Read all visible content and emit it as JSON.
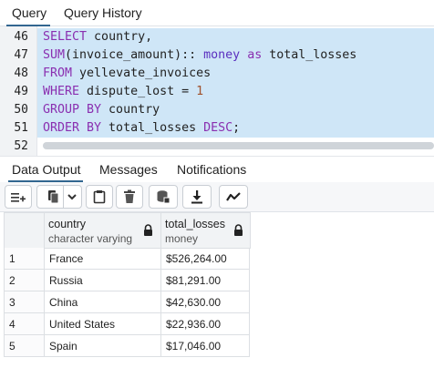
{
  "top_tabs": [
    {
      "label": "Query"
    },
    {
      "label": "Query History"
    }
  ],
  "editor": {
    "line_numbers": [
      "46",
      "47",
      "48",
      "49",
      "50",
      "51",
      "52"
    ],
    "lines": [
      [
        {
          "t": "SELECT",
          "c": "kw"
        },
        {
          "t": " country,",
          "c": ""
        }
      ],
      [
        {
          "t": "SUM",
          "c": "fn"
        },
        {
          "t": "(invoice_amount):: ",
          "c": ""
        },
        {
          "t": "money",
          "c": "tp"
        },
        {
          "t": " ",
          "c": ""
        },
        {
          "t": "as",
          "c": "kw"
        },
        {
          "t": " total_losses",
          "c": ""
        }
      ],
      [
        {
          "t": "FROM",
          "c": "kw"
        },
        {
          "t": " yellevate_invoices",
          "c": ""
        }
      ],
      [
        {
          "t": "WHERE",
          "c": "kw"
        },
        {
          "t": " dispute_lost = ",
          "c": ""
        },
        {
          "t": "1",
          "c": "num"
        }
      ],
      [
        {
          "t": "GROUP BY",
          "c": "kw"
        },
        {
          "t": " country",
          "c": ""
        }
      ],
      [
        {
          "t": "ORDER BY",
          "c": "kw"
        },
        {
          "t": " total_losses ",
          "c": ""
        },
        {
          "t": "DESC",
          "c": "kw"
        },
        {
          "t": ";",
          "c": ""
        }
      ],
      []
    ]
  },
  "bottom_tabs": [
    {
      "label": "Data Output"
    },
    {
      "label": "Messages"
    },
    {
      "label": "Notifications"
    }
  ],
  "toolbar": {
    "buttons": [
      "add-row-icon",
      "copy-icon",
      "dropdown-icon",
      "paste-icon",
      "delete-icon",
      "save-data-icon",
      "download-icon",
      "graph-icon"
    ]
  },
  "result": {
    "columns": [
      {
        "name": "country",
        "type": "character varying"
      },
      {
        "name": "total_losses",
        "type": "money"
      }
    ],
    "rows": [
      {
        "n": "1",
        "country": "France",
        "total": "$526,264.00"
      },
      {
        "n": "2",
        "country": "Russia",
        "total": "$81,291.00"
      },
      {
        "n": "3",
        "country": "China",
        "total": "$42,630.00"
      },
      {
        "n": "4",
        "country": "United States",
        "total": "$22,936.00"
      },
      {
        "n": "5",
        "country": "Spain",
        "total": "$17,046.00"
      }
    ]
  },
  "colors": {
    "accent": "#326690",
    "keyword": "#8a2fb0",
    "selection": "#cfe6f7"
  }
}
